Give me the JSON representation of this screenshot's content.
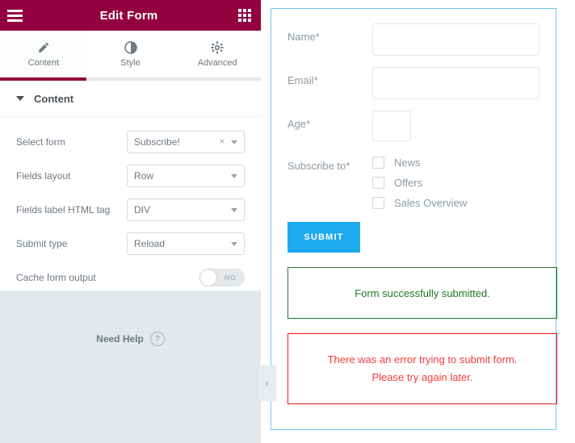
{
  "panel": {
    "title": "Edit Form",
    "menu_icon": "hamburger-menu-icon",
    "grid_icon": "apps-grid-icon",
    "tabs": [
      {
        "label": "Content",
        "icon": "pencil-icon",
        "active": true
      },
      {
        "label": "Style",
        "icon": "contrast-icon",
        "active": false
      },
      {
        "label": "Advanced",
        "icon": "gear-icon",
        "active": false
      }
    ],
    "section": {
      "title": "Content",
      "collapsed": false,
      "controls": [
        {
          "label": "Select form",
          "type": "select",
          "value": "Subscribe!",
          "clearable": true
        },
        {
          "label": "Fields layout",
          "type": "select",
          "value": "Row",
          "clearable": false
        },
        {
          "label": "Fields label HTML tag",
          "type": "select",
          "value": "DIV",
          "clearable": false
        },
        {
          "label": "Submit type",
          "type": "select",
          "value": "Reload",
          "clearable": false
        },
        {
          "label": "Cache form output",
          "type": "toggle",
          "value": "NO",
          "on": false
        }
      ]
    },
    "help": {
      "label": "Need Help",
      "icon": "question-mark-icon"
    },
    "collapse_handle": {
      "icon": "chevron-left-icon",
      "glyph": "‹"
    },
    "colors": {
      "header_bg": "#93003f",
      "panel_bg": "#e3e8ea",
      "accent": "#93003f"
    }
  },
  "preview": {
    "border_color": "#72c8ee",
    "fields": [
      {
        "label": "Name*",
        "type": "text",
        "value": "",
        "size": "wide"
      },
      {
        "label": "Email*",
        "type": "text",
        "value": "",
        "size": "wide"
      },
      {
        "label": "Age*",
        "type": "text",
        "value": "",
        "size": "narrow"
      }
    ],
    "checkbox_group": {
      "label": "Subscribe to*",
      "options": [
        {
          "label": "News",
          "checked": false
        },
        {
          "label": "Offers",
          "checked": false
        },
        {
          "label": "Sales Overview",
          "checked": false
        }
      ]
    },
    "submit_label": "SUBMIT",
    "submit_color": "#1eaaec",
    "messages": {
      "success": {
        "text": "Form successfully submitted.",
        "color": "#1f7a1f"
      },
      "error": {
        "line1": "There was an error trying to submit form.",
        "line2": "Please try again later.",
        "color": "#f53b3b"
      }
    }
  }
}
